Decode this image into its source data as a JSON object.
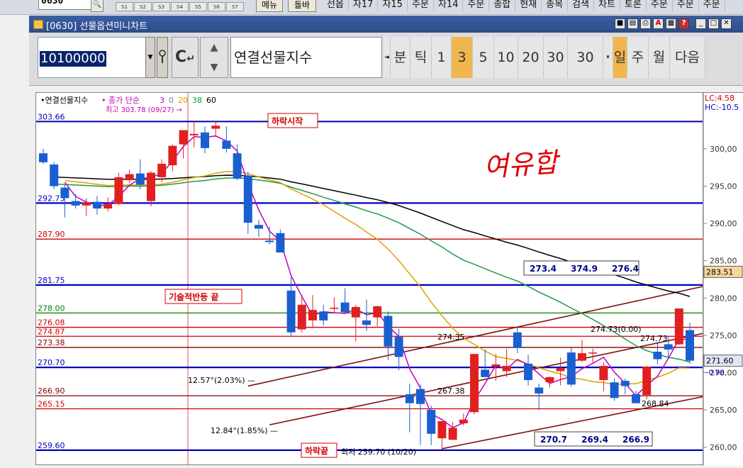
{
  "toolbar": {
    "code_value": "0630",
    "slots": [
      "S1",
      "S2",
      "S3",
      "S4",
      "S5",
      "S6",
      "S7"
    ],
    "menu_button": "메뉴",
    "collapse_button": "돌바",
    "menus": [
      "선옵",
      "자17",
      "자15",
      "주문",
      "자14",
      "주문",
      "종합",
      "현재",
      "종목",
      "검색",
      "차트",
      "토론",
      "주문",
      "주문",
      "주문"
    ]
  },
  "window": {
    "title": "[0630] 선물옵션미니차트"
  },
  "controls": {
    "code_input": "10100000",
    "c_button": "C",
    "instrument_name": "연결선물지수",
    "periods": [
      {
        "label": "분",
        "active": false
      },
      {
        "label": "틱",
        "active": false
      },
      {
        "label": "1",
        "active": false
      },
      {
        "label": "3",
        "active": true
      },
      {
        "label": "5",
        "active": false
      },
      {
        "label": "10",
        "active": false
      },
      {
        "label": "20",
        "active": false
      },
      {
        "label": "30",
        "active": false
      },
      {
        "label": "30",
        "active": false
      },
      {
        "label": "일",
        "active": true
      },
      {
        "label": "주",
        "active": false
      },
      {
        "label": "월",
        "active": false
      },
      {
        "label": "다음",
        "active": false
      }
    ]
  },
  "chart_data": {
    "type": "candlestick",
    "title": "연결선물지수",
    "legend": {
      "price": "종가",
      "ma_type": "단순",
      "ma_periods": [
        "3",
        "0",
        "20",
        "38",
        "60"
      ],
      "ma_colors": [
        "#c000c0",
        "#808080",
        "#e0a000",
        "#00a040",
        "#000000"
      ]
    },
    "ylim": [
      257.5,
      307.5
    ],
    "yticks": [
      "300,00",
      "295,00",
      "290,00",
      "285,00",
      "280,00",
      "275,00",
      "270,00",
      "265,00",
      "260,00"
    ],
    "ytick_values": [
      300,
      295,
      290,
      285,
      280,
      275,
      270,
      265,
      260
    ],
    "lc_label": "LC:4.58",
    "hc_label": "HC:-10.5",
    "current_price_label": "283.51",
    "last_price_label": "271.60",
    "last_change_label": "-0.98",
    "top_label": "303.66",
    "high_annotation": "최고 303.78 (09/27)",
    "low_annotation": "최저 259.70 (10/20)",
    "horizontal_levels": [
      {
        "label": "292.73",
        "value": 292.73,
        "color": "#0000c0"
      },
      {
        "label": "287.90",
        "value": 287.9,
        "color": "#d00000"
      },
      {
        "label": "281.75",
        "value": 281.75,
        "color": "#0000c0"
      },
      {
        "label": "278.00",
        "value": 278.0,
        "color": "#008000"
      },
      {
        "label": "276.08",
        "value": 276.08,
        "color": "#d00000"
      },
      {
        "label": "274.87",
        "value": 274.87,
        "color": "#d00000"
      },
      {
        "label": "273.38",
        "value": 273.38,
        "color": "#800000"
      },
      {
        "label": "270.70",
        "value": 270.7,
        "color": "#0000c0"
      },
      {
        "label": "266.90",
        "value": 266.9,
        "color": "#800000"
      },
      {
        "label": "265.15",
        "value": 265.15,
        "color": "#d00000"
      },
      {
        "label": "259.60",
        "value": 259.6,
        "color": "#0000c0"
      }
    ],
    "top_line_value": 303.66,
    "annotations": [
      "하락시작",
      "기술적반등 끝",
      "하락끝",
      "12.57°(2.03%)",
      "12.84°(1.85%)",
      "274.35",
      "267.38",
      "274.73(0.00)",
      "274.73",
      "268.84"
    ],
    "handwriting": "여유합",
    "box_top": [
      "273.4",
      "374.9",
      "276.4"
    ],
    "box_bottom": [
      "270.7",
      "269.4",
      "266.9"
    ],
    "candles": [
      {
        "o": 299.4,
        "h": 300.0,
        "l": 298.0,
        "c": 298.2
      },
      {
        "o": 297.9,
        "h": 298.2,
        "l": 294.6,
        "c": 295.0
      },
      {
        "o": 294.8,
        "h": 295.2,
        "l": 290.8,
        "c": 293.4
      },
      {
        "o": 293.0,
        "h": 294.0,
        "l": 292.0,
        "c": 292.4
      },
      {
        "o": 292.4,
        "h": 293.4,
        "l": 291.0,
        "c": 292.8
      },
      {
        "o": 292.9,
        "h": 293.7,
        "l": 291.2,
        "c": 292.0
      },
      {
        "o": 292.0,
        "h": 293.5,
        "l": 291.6,
        "c": 292.6
      },
      {
        "o": 292.6,
        "h": 296.8,
        "l": 292.4,
        "c": 296.2
      },
      {
        "o": 295.8,
        "h": 297.2,
        "l": 295.4,
        "c": 296.6
      },
      {
        "o": 296.7,
        "h": 298.6,
        "l": 294.6,
        "c": 295.2
      },
      {
        "o": 293.0,
        "h": 297.0,
        "l": 292.3,
        "c": 296.8
      },
      {
        "o": 296.2,
        "h": 298.6,
        "l": 295.5,
        "c": 298.0
      },
      {
        "o": 297.8,
        "h": 300.6,
        "l": 297.0,
        "c": 300.4
      },
      {
        "o": 300.6,
        "h": 301.6,
        "l": 298.7,
        "c": 302.5
      },
      {
        "o": 301.8,
        "h": 303.8,
        "l": 300.2,
        "c": 302.0
      },
      {
        "o": 302.2,
        "h": 303.0,
        "l": 299.4,
        "c": 300.1
      },
      {
        "o": 302.7,
        "h": 303.7,
        "l": 301.6,
        "c": 303.1
      },
      {
        "o": 301.1,
        "h": 303.0,
        "l": 299.5,
        "c": 300.0
      },
      {
        "o": 299.4,
        "h": 300.6,
        "l": 295.8,
        "c": 296.0
      },
      {
        "o": 296.4,
        "h": 296.9,
        "l": 288.6,
        "c": 290.1
      },
      {
        "o": 289.8,
        "h": 290.5,
        "l": 288.2,
        "c": 289.3
      },
      {
        "o": 287.7,
        "h": 289.6,
        "l": 287.2,
        "c": 287.5
      },
      {
        "o": 288.7,
        "h": 289.2,
        "l": 286.3,
        "c": 286.1
      },
      {
        "o": 281.0,
        "h": 282.8,
        "l": 274.9,
        "c": 275.4
      },
      {
        "o": 275.8,
        "h": 280.4,
        "l": 275.4,
        "c": 279.1
      },
      {
        "o": 277.0,
        "h": 280.4,
        "l": 276.0,
        "c": 278.4
      },
      {
        "o": 278.2,
        "h": 279.1,
        "l": 276.3,
        "c": 277.0
      },
      {
        "o": 278.6,
        "h": 280.1,
        "l": 278.0,
        "c": 278.7
      },
      {
        "o": 279.4,
        "h": 281.3,
        "l": 278.0,
        "c": 278.1
      },
      {
        "o": 277.4,
        "h": 279.1,
        "l": 274.2,
        "c": 278.8
      },
      {
        "o": 277.0,
        "h": 279.8,
        "l": 275.6,
        "c": 276.4
      },
      {
        "o": 277.4,
        "h": 279.0,
        "l": 276.2,
        "c": 278.9
      },
      {
        "o": 277.6,
        "h": 278.2,
        "l": 271.7,
        "c": 273.5
      },
      {
        "o": 274.8,
        "h": 275.9,
        "l": 270.3,
        "c": 272.1
      },
      {
        "o": 267.1,
        "h": 268.5,
        "l": 262.0,
        "c": 265.9
      },
      {
        "o": 267.8,
        "h": 268.4,
        "l": 260.3,
        "c": 265.8
      },
      {
        "o": 265.0,
        "h": 265.6,
        "l": 260.3,
        "c": 261.8
      },
      {
        "o": 261.2,
        "h": 263.4,
        "l": 259.7,
        "c": 263.5
      },
      {
        "o": 261.0,
        "h": 263.4,
        "l": 261.0,
        "c": 262.6
      },
      {
        "o": 263.2,
        "h": 264.5,
        "l": 262.9,
        "c": 263.7
      },
      {
        "o": 264.7,
        "h": 272.5,
        "l": 264.4,
        "c": 272.5
      },
      {
        "o": 270.4,
        "h": 273.1,
        "l": 269.4,
        "c": 269.4
      },
      {
        "o": 270.8,
        "h": 272.5,
        "l": 268.9,
        "c": 271.1
      },
      {
        "o": 270.2,
        "h": 273.2,
        "l": 269.4,
        "c": 270.9
      },
      {
        "o": 275.4,
        "h": 276.0,
        "l": 272.6,
        "c": 273.3
      },
      {
        "o": 271.2,
        "h": 272.4,
        "l": 268.3,
        "c": 269.0
      },
      {
        "o": 268.0,
        "h": 268.5,
        "l": 265.0,
        "c": 267.2
      },
      {
        "o": 268.7,
        "h": 269.5,
        "l": 268.0,
        "c": 269.4
      },
      {
        "o": 270.2,
        "h": 272.0,
        "l": 268.3,
        "c": 270.6
      },
      {
        "o": 272.7,
        "h": 273.3,
        "l": 268.1,
        "c": 268.4
      },
      {
        "o": 271.6,
        "h": 274.4,
        "l": 271.4,
        "c": 272.6
      },
      {
        "o": 272.6,
        "h": 273.2,
        "l": 271.3,
        "c": 272.7
      },
      {
        "o": 269.0,
        "h": 271.4,
        "l": 267.5,
        "c": 270.9
      },
      {
        "o": 268.7,
        "h": 269.2,
        "l": 266.2,
        "c": 266.6
      },
      {
        "o": 268.9,
        "h": 269.2,
        "l": 267.1,
        "c": 268.2
      },
      {
        "o": 267.1,
        "h": 267.6,
        "l": 265.9,
        "c": 265.9
      },
      {
        "o": 267.0,
        "h": 270.9,
        "l": 266.4,
        "c": 270.8
      },
      {
        "o": 272.8,
        "h": 273.9,
        "l": 271.1,
        "c": 271.8
      },
      {
        "o": 273.8,
        "h": 274.8,
        "l": 271.9,
        "c": 273.1
      },
      {
        "o": 273.8,
        "h": 278.4,
        "l": 273.7,
        "c": 278.6
      },
      {
        "o": 275.7,
        "h": 276.7,
        "l": 271.2,
        "c": 271.6
      }
    ]
  }
}
